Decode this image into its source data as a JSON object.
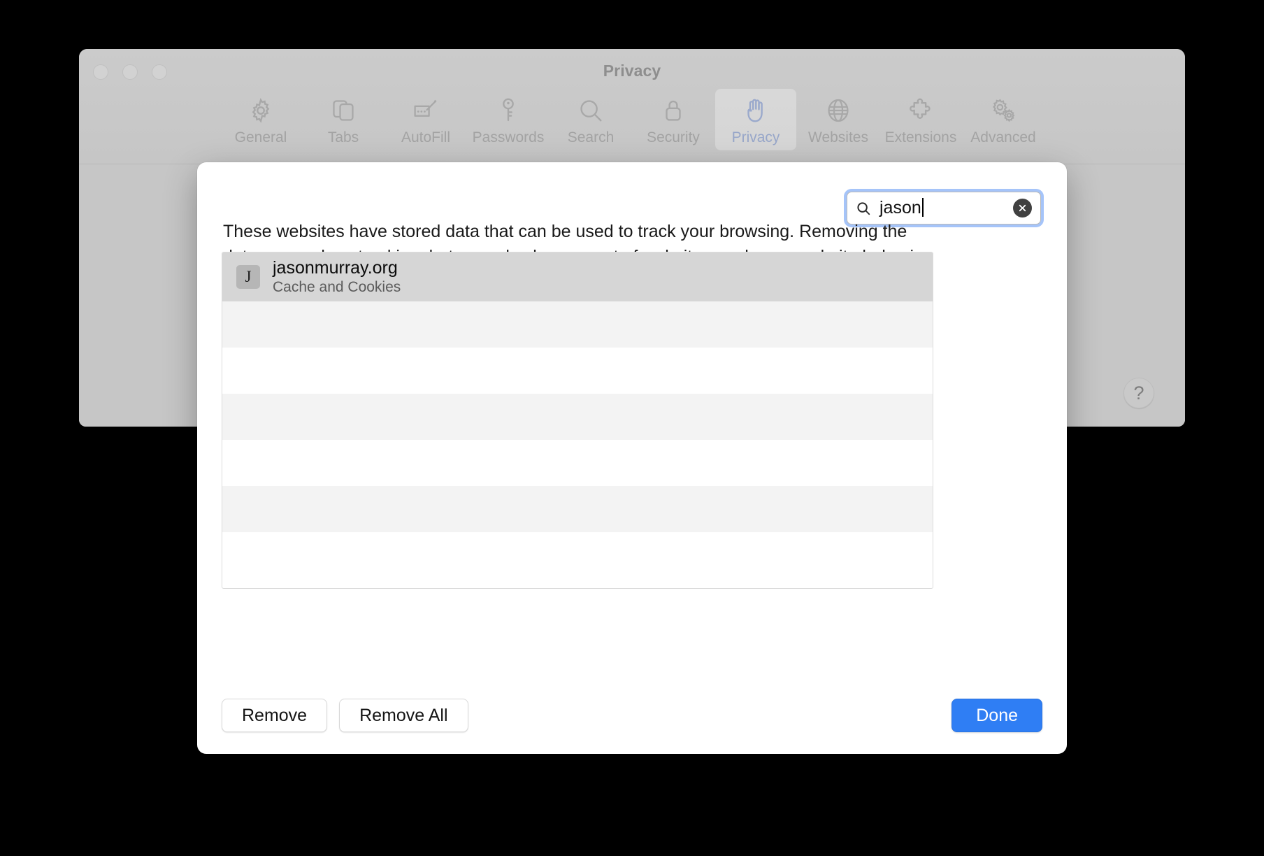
{
  "window": {
    "title": "Privacy",
    "traffic_lights": [
      "close",
      "minimize",
      "zoom"
    ],
    "help_label": "?"
  },
  "toolbar": {
    "tabs": [
      {
        "label": "General",
        "icon": "gear-icon",
        "selected": false
      },
      {
        "label": "Tabs",
        "icon": "tabs-icon",
        "selected": false
      },
      {
        "label": "AutoFill",
        "icon": "autofill-icon",
        "selected": false
      },
      {
        "label": "Passwords",
        "icon": "key-icon",
        "selected": false
      },
      {
        "label": "Search",
        "icon": "magnifier-icon",
        "selected": false
      },
      {
        "label": "Security",
        "icon": "lock-icon",
        "selected": false
      },
      {
        "label": "Privacy",
        "icon": "hand-icon",
        "selected": true
      },
      {
        "label": "Websites",
        "icon": "globe-icon",
        "selected": false
      },
      {
        "label": "Extensions",
        "icon": "puzzle-icon",
        "selected": false
      },
      {
        "label": "Advanced",
        "icon": "double-gear-icon",
        "selected": false
      }
    ]
  },
  "sheet": {
    "search": {
      "value": "jason",
      "placeholder": "Search",
      "icon": "search-icon",
      "clear_icon": "clear-circle-icon",
      "focused": true
    },
    "description": "These websites have stored data that can be used to track your browsing. Removing the data may reduce tracking, but may also log you out of websites or change website behavior.",
    "list": {
      "rows": [
        {
          "favicon_letter": "J",
          "title": "jasonmurray.org",
          "subtitle": "Cache and Cookies",
          "selected": true
        }
      ],
      "empty_row_count": 6
    },
    "buttons": {
      "remove": "Remove",
      "remove_all": "Remove All",
      "done": "Done"
    }
  },
  "colors": {
    "accent": "#2f7ef4",
    "selected_tab": "#97a6c9",
    "row_selected": "#d6d6d6",
    "row_alt": "#f3f3f3",
    "window_bg": "#c6c6c6"
  }
}
